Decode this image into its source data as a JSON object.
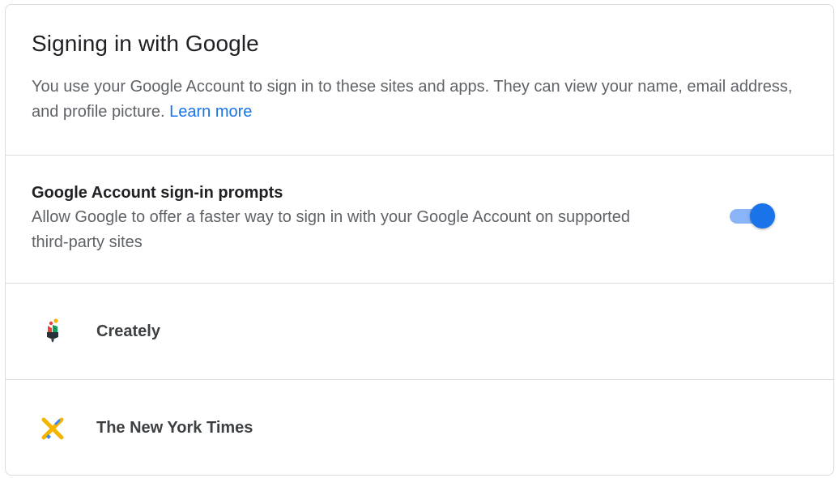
{
  "header": {
    "title": "Signing in with Google",
    "description": "You use your Google Account to sign in to these sites and apps. They can view your name, email address, and profile picture.",
    "learn_more": "Learn more"
  },
  "prompts": {
    "title": "Google Account sign-in prompts",
    "description": "Allow Google to offer a faster way to sign in with your Google Account on supported third-party sites",
    "toggle_on": true
  },
  "sites": [
    {
      "name": "Creately",
      "icon": "creately-logo-icon"
    },
    {
      "name": "The New York Times",
      "icon": "nytimes-logo-icon"
    }
  ],
  "colors": {
    "accent": "#1a73e8",
    "toggle_track": "#8ab4f8",
    "divider": "#dadce0"
  }
}
